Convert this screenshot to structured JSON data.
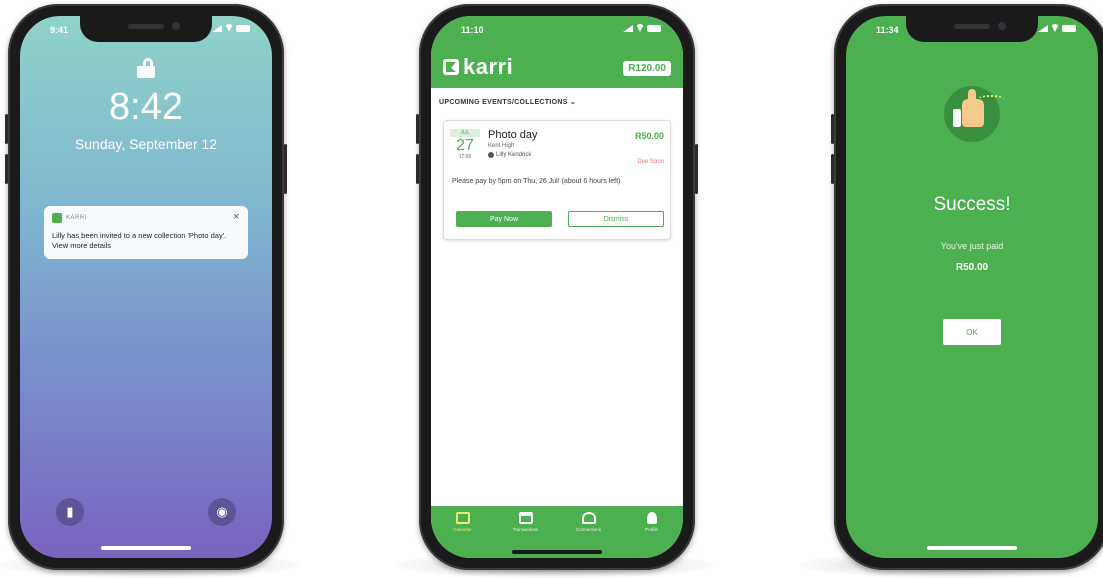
{
  "colors": {
    "brand_green": "#4caf50",
    "alert_red": "#e57373",
    "bezel": "#1a1a1a"
  },
  "lockscreen": {
    "status_time": "9:41",
    "time": "8:42",
    "date": "Sunday, September 12",
    "notification": {
      "app": "KARRI",
      "close": "×",
      "message": "Lilly has been invited to a new collection 'Photo day'.  View more details"
    },
    "flashlight_icon": "flashlight-icon",
    "camera_icon": "camera-icon"
  },
  "app": {
    "status_time": "11:10",
    "logo": "karri",
    "balance": "R120.00",
    "section_title": "UPCOMING EVENTS/COLLECTIONS",
    "section_chevron": "⌄",
    "event": {
      "month": "JUL",
      "day": "27",
      "time": "17:00",
      "title": "Photo day",
      "school": "Kent High",
      "student": "Lilly Kendrick",
      "price": "R50.00",
      "due": "Due Soon",
      "message": "Please pay by 5pm on Thu, 26 Jul! (about 6 hours left)",
      "pay_label": "Pay Now",
      "dismiss_label": "Dismiss"
    },
    "nav": [
      {
        "label": "Calendar",
        "icon": "calendar-icon"
      },
      {
        "label": "Transactions",
        "icon": "card-icon"
      },
      {
        "label": "Connections",
        "icon": "people-icon"
      },
      {
        "label": "Profile",
        "icon": "person-icon"
      }
    ]
  },
  "success": {
    "status_time": "11:34",
    "icon": "thumbs-up-icon",
    "title": "Success!",
    "message": "You've just paid",
    "amount": "R50.00",
    "ok_label": "OK"
  }
}
